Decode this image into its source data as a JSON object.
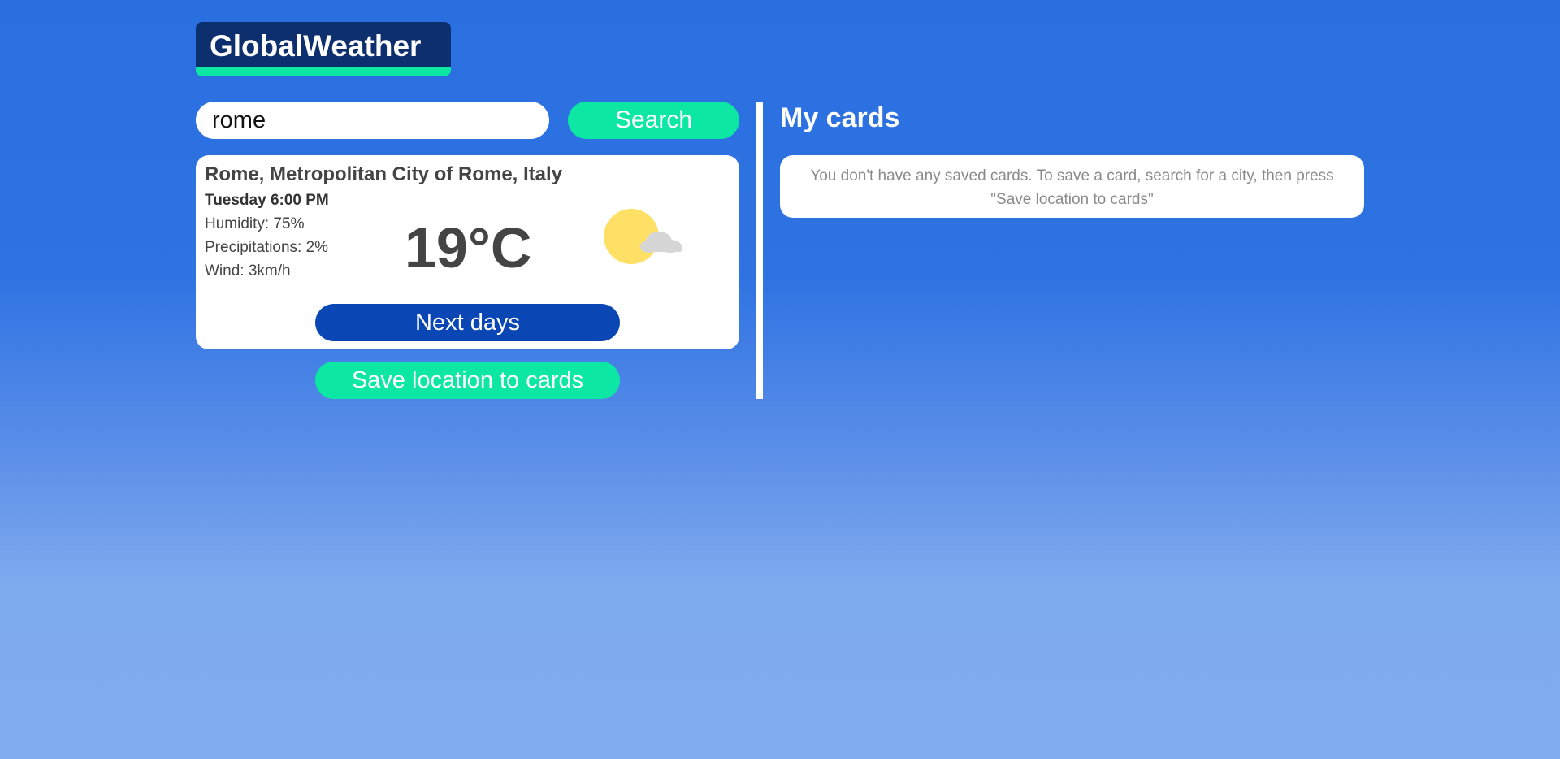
{
  "app": {
    "logo_text": "GlobalWeather"
  },
  "search": {
    "value": "rome",
    "button_label": "Search"
  },
  "weather": {
    "location": "Rome, Metropolitan City of Rome, Italy",
    "datetime": "Tuesday 6:00 PM",
    "humidity": "Humidity: 75%",
    "precipitations": "Precipitations: 2%",
    "wind": "Wind: 3km/h",
    "temperature": "19°C",
    "icon": "partly-cloudy-icon",
    "next_days_label": "Next days"
  },
  "actions": {
    "save_label": "Save location to cards"
  },
  "cards": {
    "title": "My cards",
    "empty_message": "You don't have any saved cards. To save a card, search for a city, then press \"Save location to cards\""
  },
  "colors": {
    "accent": "#0ce8a4",
    "logo_bg": "#0d2f6e",
    "primary_button": "#0a47b4",
    "background_top": "#2a6fe0",
    "background_bottom": "#80abef",
    "sun": "#ffe066",
    "cloud": "#d6d6d6"
  }
}
